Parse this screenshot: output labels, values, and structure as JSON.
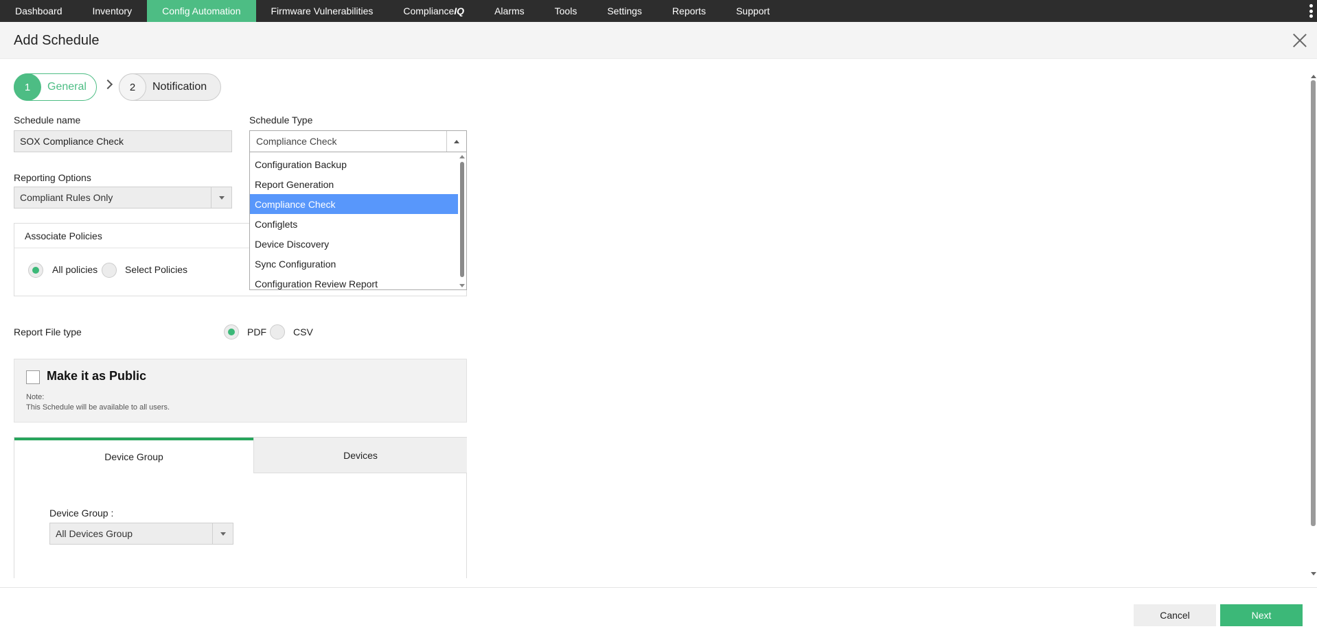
{
  "nav": {
    "items": [
      "Dashboard",
      "Inventory",
      "Config Automation",
      "Firmware Vulnerabilities",
      "Compliance",
      "Alarms",
      "Tools",
      "Settings",
      "Reports",
      "Support"
    ],
    "compliance_suffix": "IQ",
    "active": "Config Automation",
    "accent_color": "#4dbd84"
  },
  "dialog": {
    "title": "Add Schedule"
  },
  "steps": [
    {
      "number": "1",
      "label": "General"
    },
    {
      "number": "2",
      "label": "Notification"
    }
  ],
  "form": {
    "schedule_name_label": "Schedule name",
    "schedule_name_value": "SOX Compliance Check",
    "schedule_type_label": "Schedule Type",
    "schedule_type_value": "Compliance Check",
    "schedule_type_options": [
      "Configuration Backup",
      "Report Generation",
      "Compliance Check",
      "Configlets",
      "Device Discovery",
      "Sync Configuration",
      "Configuration Review Report"
    ],
    "reporting_options_label": "Reporting Options",
    "reporting_options_value": "Compliant Rules Only",
    "associate_policies_label": "Associate Policies",
    "policy_all": "All policies",
    "policy_select": "Select Policies",
    "report_file_type_label": "Report File type",
    "file_pdf": "PDF",
    "file_csv": "CSV",
    "public_title": "Make it as Public",
    "public_note_label": "Note:",
    "public_note_text": "This Schedule will be available to all users."
  },
  "tabs": {
    "device_group": "Device Group",
    "devices": "Devices",
    "device_group_field_label": "Device Group :",
    "device_group_value": "All Devices Group"
  },
  "footer": {
    "cancel": "Cancel",
    "next": "Next"
  }
}
